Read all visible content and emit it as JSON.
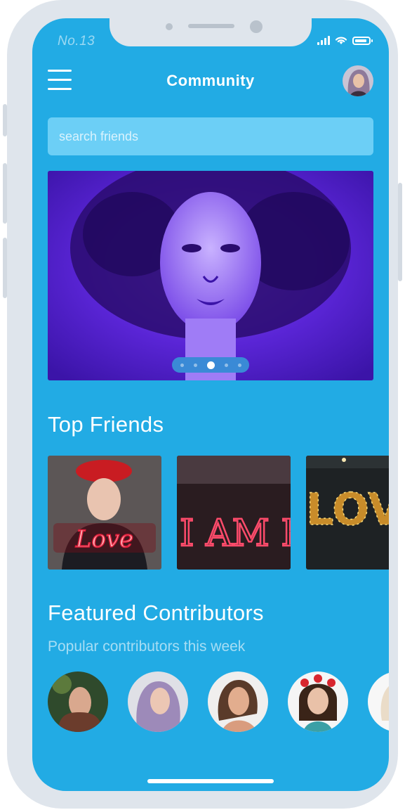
{
  "status_bar": {
    "carrier": "No.13",
    "icons": [
      "signal-icon",
      "wifi-icon",
      "battery-icon"
    ]
  },
  "header": {
    "title": "Community",
    "menu_icon": "hamburger-icon",
    "avatar": "profile-avatar"
  },
  "search": {
    "placeholder": "search friends",
    "value": ""
  },
  "hero": {
    "description_icon": "portrait-artwork",
    "carousel_pages": 5,
    "active_page": 3
  },
  "top_friends": {
    "heading": "Top Friends",
    "items": [
      {
        "name": "friend-card-love",
        "sign_text": "Love"
      },
      {
        "name": "friend-card-iambold",
        "sign_text": "I AM BOL"
      },
      {
        "name": "friend-card-lov",
        "sign_text": "LOV"
      }
    ]
  },
  "featured": {
    "heading": "Featured Contributors",
    "subheading": "Popular contributors this week",
    "count": 5
  },
  "colors": {
    "screen": "#22abe4",
    "search_bg": "#6ccff6",
    "frame": "#dfe5ec",
    "hero": "#5a25d6"
  }
}
